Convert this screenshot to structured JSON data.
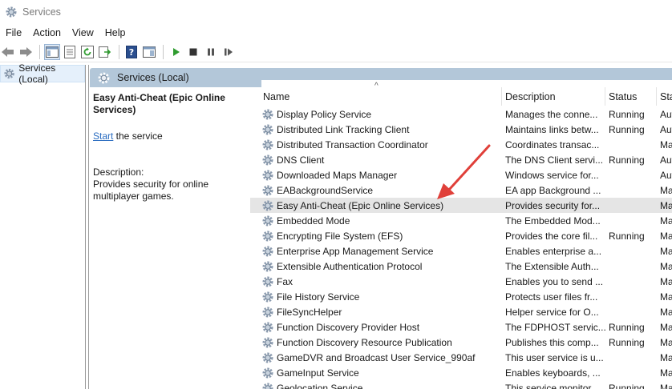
{
  "window": {
    "title": "Services"
  },
  "menu": [
    "File",
    "Action",
    "View",
    "Help"
  ],
  "toolbar": {
    "buttons": [
      "back-icon",
      "forward-icon",
      "show-hide-tree-icon",
      "properties-icon",
      "refresh-icon",
      "export-list-icon",
      "help-icon",
      "console-icon",
      "play-icon",
      "stop-icon",
      "pause-icon",
      "restart-icon"
    ]
  },
  "tree": {
    "root_label": "Services (Local)"
  },
  "band": {
    "title": "Services (Local)"
  },
  "details": {
    "service_title": "Easy Anti-Cheat (Epic Online Services)",
    "start_link": "Start",
    "start_suffix": " the service",
    "description_label": "Description:",
    "description_text": "Provides security for online multiplayer games."
  },
  "table": {
    "columns": {
      "name": "Name",
      "description": "Description",
      "status": "Status",
      "startup": "Star"
    },
    "sort_indicator": "^",
    "rows": [
      {
        "name": "Display Policy Service",
        "description": "Manages the conne...",
        "status": "Running",
        "startup": "Aut"
      },
      {
        "name": "Distributed Link Tracking Client",
        "description": "Maintains links betw...",
        "status": "Running",
        "startup": "Aut"
      },
      {
        "name": "Distributed Transaction Coordinator",
        "description": "Coordinates transac...",
        "status": "",
        "startup": "Ma"
      },
      {
        "name": "DNS Client",
        "description": "The DNS Client servi...",
        "status": "Running",
        "startup": "Aut"
      },
      {
        "name": "Downloaded Maps Manager",
        "description": "Windows service for...",
        "status": "",
        "startup": "Aut"
      },
      {
        "name": "EABackgroundService",
        "description": "EA app Background ...",
        "status": "",
        "startup": "Ma"
      },
      {
        "name": "Easy Anti-Cheat (Epic Online Services)",
        "description": "Provides security for...",
        "status": "",
        "startup": "Ma"
      },
      {
        "name": "Embedded Mode",
        "description": "The Embedded Mod...",
        "status": "",
        "startup": "Ma"
      },
      {
        "name": "Encrypting File System (EFS)",
        "description": "Provides the core fil...",
        "status": "Running",
        "startup": "Ma"
      },
      {
        "name": "Enterprise App Management Service",
        "description": "Enables enterprise a...",
        "status": "",
        "startup": "Ma"
      },
      {
        "name": "Extensible Authentication Protocol",
        "description": "The Extensible Auth...",
        "status": "",
        "startup": "Ma"
      },
      {
        "name": "Fax",
        "description": "Enables you to send ...",
        "status": "",
        "startup": "Ma"
      },
      {
        "name": "File History Service",
        "description": "Protects user files fr...",
        "status": "",
        "startup": "Ma"
      },
      {
        "name": "FileSyncHelper",
        "description": "Helper service for O...",
        "status": "",
        "startup": "Ma"
      },
      {
        "name": "Function Discovery Provider Host",
        "description": "The FDPHOST servic...",
        "status": "Running",
        "startup": "Ma"
      },
      {
        "name": "Function Discovery Resource Publication",
        "description": "Publishes this comp...",
        "status": "Running",
        "startup": "Ma"
      },
      {
        "name": "GameDVR and Broadcast User Service_990af",
        "description": "This user service is u...",
        "status": "",
        "startup": "Ma"
      },
      {
        "name": "GameInput Service",
        "description": "Enables keyboards, ...",
        "status": "",
        "startup": "Ma"
      },
      {
        "name": "Geolocation Service",
        "description": "This service monitor...",
        "status": "Running",
        "startup": "Ma"
      }
    ],
    "selected_index": 6
  },
  "colors": {
    "band": "#b3c7d9",
    "link": "#2a6cc0",
    "annotation_arrow": "#e0403a",
    "selected_row": "#e5e5e5"
  }
}
